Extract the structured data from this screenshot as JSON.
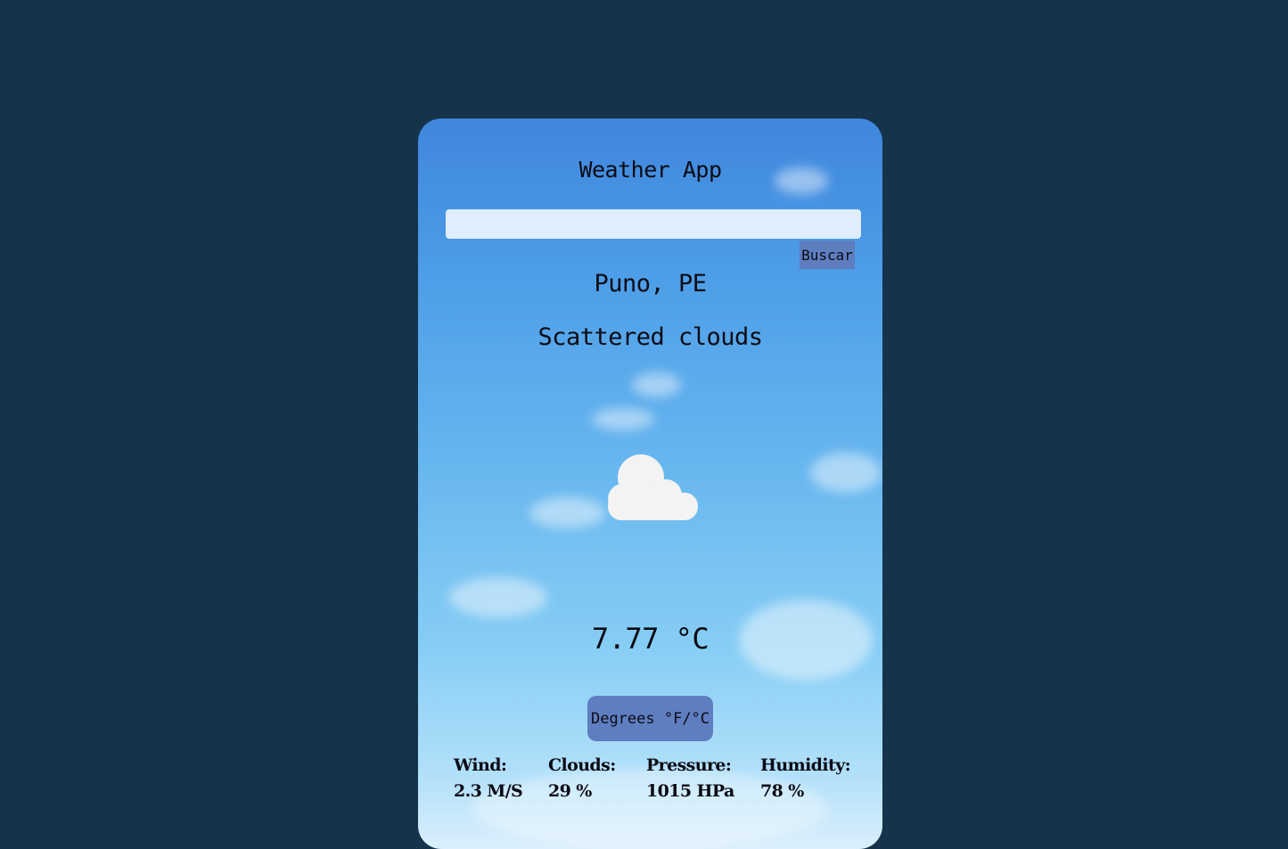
{
  "app": {
    "title": "Weather App"
  },
  "search": {
    "value": "",
    "placeholder": "",
    "button_label": "Buscar"
  },
  "weather": {
    "location": "Puno, PE",
    "description": "Scattered clouds",
    "icon": "cloud-icon",
    "temperature": "7.77 °C"
  },
  "units_toggle": {
    "label": "Degrees °F/°C"
  },
  "stats": {
    "wind": {
      "label": "Wind:",
      "value": "2.3 M/S"
    },
    "clouds": {
      "label": "Clouds:",
      "value": "29 %"
    },
    "pressure": {
      "label": "Pressure:",
      "value": "1015 HPa"
    },
    "humidity": {
      "label": "Humidity:",
      "value": "78 %"
    }
  },
  "colors": {
    "page_background": "#15344b",
    "button_background": "#5e7ec0",
    "input_background": "#deeefd",
    "sky_top": "#3f86dd",
    "sky_bottom": "#dbeffc",
    "text": "#0b0b14",
    "cloud_icon": "#f3f3f3"
  }
}
